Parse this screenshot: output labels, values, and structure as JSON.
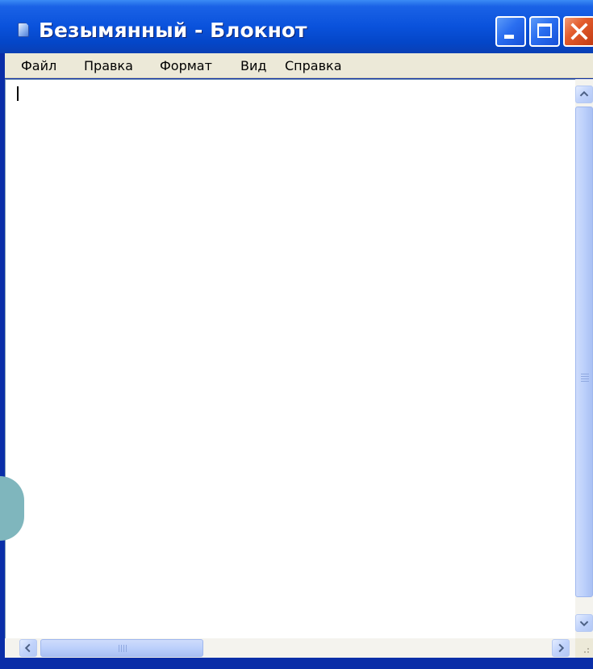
{
  "window": {
    "title": "Безымянный - Блокнот",
    "icons": {
      "app": "notepad-icon",
      "minimize": "minimize-icon",
      "maximize": "maximize-icon",
      "close": "close-icon"
    }
  },
  "menu": {
    "items": [
      "Файл",
      "Правка",
      "Формат",
      "Вид",
      "Справка"
    ]
  },
  "editor": {
    "text": ""
  },
  "scrollbars": {
    "icons": {
      "up": "chevron-up-icon",
      "down": "chevron-down-icon",
      "left": "chevron-left-icon",
      "right": "chevron-right-icon"
    }
  },
  "colors": {
    "titlebar": "#0a52dc",
    "menubar": "#ece9d8",
    "close_button": "#e35c2c",
    "scrollbar_thumb": "#bcd0fb"
  }
}
